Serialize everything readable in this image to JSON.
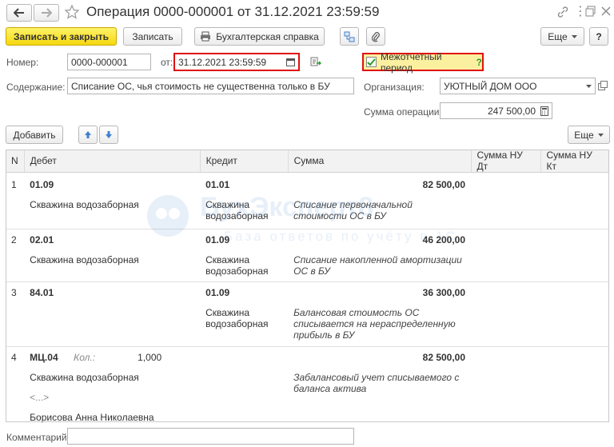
{
  "window": {
    "title": "Операция 0000-000001 от 31.12.2021 23:59:59",
    "more_label": "⋮"
  },
  "toolbar": {
    "save_close": "Записать и закрыть",
    "save": "Записать",
    "report": "Бухгалтерская справка",
    "more": "Еще",
    "help": "?"
  },
  "fields": {
    "number_label": "Номер:",
    "number_value": "0000-000001",
    "date_label": "от:",
    "date_value": "31.12.2021 23:59:59",
    "interperiod_label": "Межотчетный период",
    "interperiod_help": "?",
    "content_label": "Содержание:",
    "content_value": "Списание ОС, чья стоимость не существенна только в БУ",
    "org_label": "Организация:",
    "org_value": "УЮТНЫЙ ДОМ ООО",
    "sum_label": "Сумма операции:",
    "sum_value": "247 500,00"
  },
  "table_toolbar": {
    "add": "Добавить",
    "more": "Еще"
  },
  "table": {
    "headers": [
      "N",
      "Дебет",
      "Кредит",
      "Сумма",
      "Сумма НУ Дт",
      "Сумма НУ Кт"
    ],
    "rows": [
      {
        "n": "1",
        "debit_account": "01.09",
        "debit_qty_label": "",
        "debit_qty": "",
        "debit_sub1": "Скважина водозаборная",
        "debit_sub2": "",
        "debit_sub3": "",
        "credit_account": "01.01",
        "credit_sub": "Скважина водозаборная",
        "sum": "82 500,00",
        "comment": "Списание первоначальной стоимости ОС в БУ"
      },
      {
        "n": "2",
        "debit_account": "02.01",
        "debit_qty_label": "",
        "debit_qty": "",
        "debit_sub1": "Скважина водозаборная",
        "debit_sub2": "",
        "debit_sub3": "",
        "credit_account": "01.09",
        "credit_sub": "Скважина водозаборная",
        "sum": "46 200,00",
        "comment": "Списание накопленной амортизации ОС в БУ"
      },
      {
        "n": "3",
        "debit_account": "84.01",
        "debit_qty_label": "",
        "debit_qty": "",
        "debit_sub1": "",
        "debit_sub2": "",
        "debit_sub3": "",
        "credit_account": "01.09",
        "credit_sub": "Скважина водозаборная",
        "sum": "36 300,00",
        "comment": "Балансовая стоимость ОС списывается на нераспределенную прибыль в БУ"
      },
      {
        "n": "4",
        "debit_account": "МЦ.04",
        "debit_qty_label": "Кол.:",
        "debit_qty": "1,000",
        "debit_sub1": "Скважина водозаборная",
        "debit_sub2": "<...>",
        "debit_sub3": "Борисова Анна Николаевна",
        "credit_account": "",
        "credit_sub": "",
        "sum": "82 500,00",
        "comment": "Забалансовый учет списываемого с баланса актива"
      }
    ]
  },
  "footer": {
    "comment_label": "Комментарий:",
    "comment_value": ""
  },
  "watermark": {
    "line1": "БухЭксперт8",
    "line2": "База ответов по учёту в 1С"
  },
  "colors": {
    "primary_button": "#f5d80f",
    "highlight_border": "#e01010",
    "checkbox_highlight": "#fbf0a0",
    "icon_blue": "#3f7fcf"
  }
}
